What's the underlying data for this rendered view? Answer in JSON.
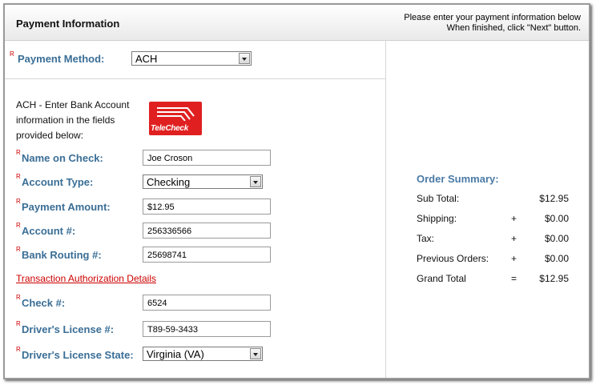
{
  "header": {
    "title": "Payment Information",
    "instruction_line1": "Please enter your payment information below",
    "instruction_line2": "When finished, click \"Next\" button."
  },
  "required_marker": "R",
  "payment_method": {
    "label": "Payment Method:",
    "value": "ACH"
  },
  "ach_note": "ACH - Enter Bank Account information in the fields provided below:",
  "logo_text": "TeleCheck",
  "fields": {
    "name_on_check": {
      "label": "Name on Check:",
      "value": "Joe Croson"
    },
    "account_type": {
      "label": "Account Type:",
      "value": "Checking"
    },
    "payment_amount": {
      "label": "Payment Amount:",
      "value": "$12.95"
    },
    "account_number": {
      "label": "Account #:",
      "value": "256336566"
    },
    "routing_number": {
      "label": "Bank Routing #:",
      "value": "25698741"
    },
    "check_number": {
      "label": "Check #:",
      "value": "6524"
    },
    "drivers_license": {
      "label": "Driver's License #:",
      "value": "T89-59-3433"
    },
    "drivers_license_state": {
      "label": "Driver's License State:",
      "value": "Virginia (VA)"
    }
  },
  "auth_link": "Transaction Authorization Details",
  "order_summary": {
    "title": "Order Summary:",
    "rows": [
      {
        "name": "Sub Total:",
        "op": "",
        "amount": "$12.95"
      },
      {
        "name": "Shipping:",
        "op": "+",
        "amount": "$0.00"
      },
      {
        "name": "Tax:",
        "op": "+",
        "amount": "$0.00"
      },
      {
        "name": "Previous Orders:",
        "op": "+",
        "amount": "$0.00"
      },
      {
        "name": "Grand Total",
        "op": "=",
        "amount": "$12.95"
      }
    ]
  },
  "colors": {
    "label_blue": "#3a6e96",
    "required_red": "#cc0000",
    "logo_red": "#e02020"
  }
}
